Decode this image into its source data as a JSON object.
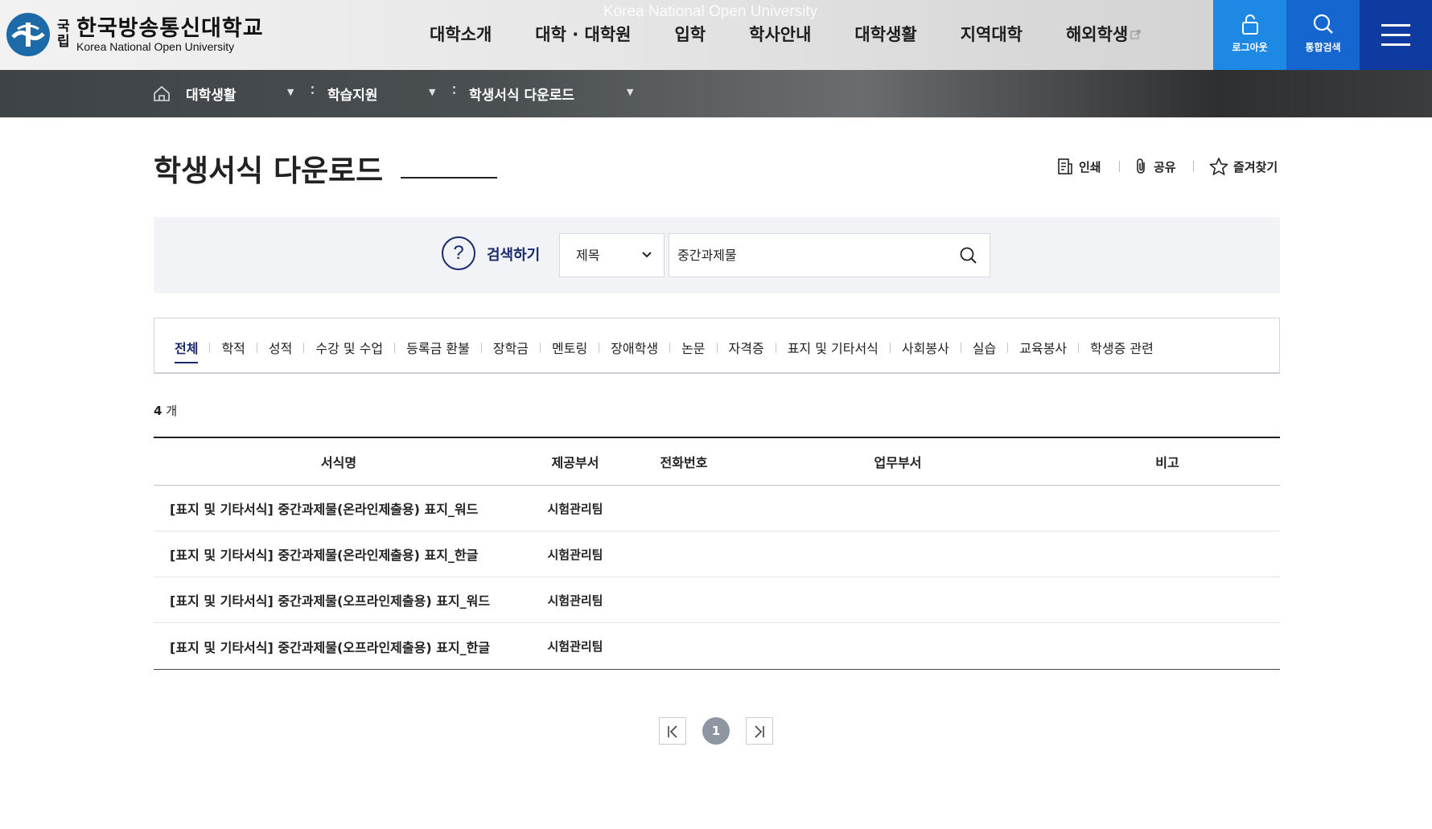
{
  "header": {
    "logo_guk": "국립",
    "logo_name_ko": "한국방송통신대학교",
    "logo_name_en": "Korea National Open University",
    "watermark": "Korea National Open University",
    "nav": [
      "대학소개",
      "대학 · 대학원",
      "입학",
      "학사안내",
      "대학생활",
      "지역대학",
      "해외학생"
    ],
    "logout_label": "로그아웃",
    "search_label": "통합검색",
    "colors": {
      "logout_bg": "#1e88e5",
      "search_bg": "#1566cf",
      "menu_bg": "#0f3aa0"
    }
  },
  "breadcrumb": {
    "icon": "home-icon",
    "items": [
      "대학생활",
      "학습지원",
      "학생서식 다운로드"
    ]
  },
  "page": {
    "title": "학생서식 다운로드",
    "utils": {
      "print": "인쇄",
      "share": "공유",
      "favorite": "즐겨찾기"
    }
  },
  "search": {
    "label": "검색하기",
    "help_glyph": "?",
    "field_select": "제목",
    "query": "중간과제물"
  },
  "tabs": {
    "active": "전체",
    "items": [
      "전체",
      "학적",
      "성적",
      "수강 및 수업",
      "등록금 환불",
      "장학금",
      "멘토링",
      "장애학생",
      "논문",
      "자격증",
      "표지 및 기타서식",
      "사회봉사",
      "실습",
      "교육봉사",
      "학생증 관련"
    ]
  },
  "result": {
    "count": "4",
    "unit": "개"
  },
  "table": {
    "headers": [
      "서식명",
      "제공부서",
      "전화번호",
      "업무부서",
      "비고"
    ],
    "rows": [
      [
        "[표지 및 기타서식] 중간과제물(온라인제출용) 표지_워드",
        "시험관리팀",
        "",
        "",
        ""
      ],
      [
        "[표지 및 기타서식] 중간과제물(온라인제출용) 표지_한글",
        "시험관리팀",
        "",
        "",
        ""
      ],
      [
        "[표지 및 기타서식] 중간과제물(오프라인제출용) 표지_워드",
        "시험관리팀",
        "",
        "",
        ""
      ],
      [
        "[표지 및 기타서식] 중간과제물(오프라인제출용) 표지_한글",
        "시험관리팀",
        "",
        "",
        ""
      ]
    ]
  },
  "pagination": {
    "current": "1"
  }
}
